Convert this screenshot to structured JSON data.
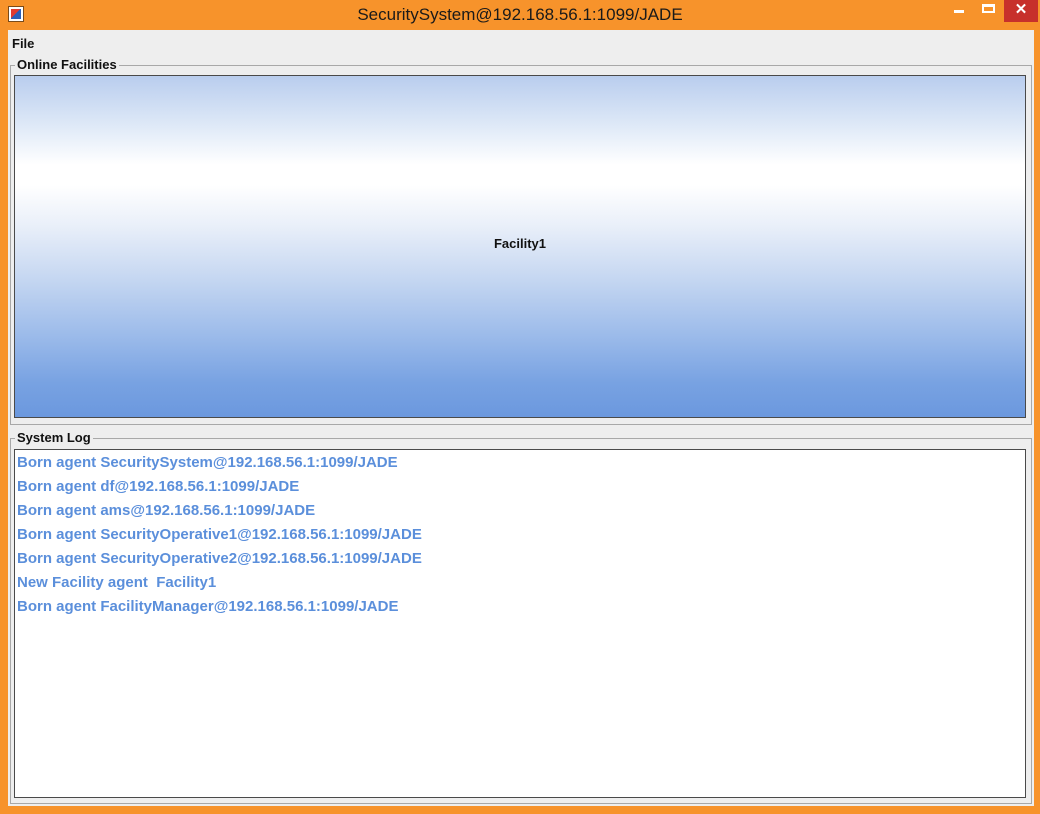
{
  "window": {
    "title": "SecuritySystem@192.168.56.1:1099/JADE",
    "close_glyph": "✕",
    "icon": "java-app-icon"
  },
  "menu": {
    "file_label": "File"
  },
  "facilities_panel": {
    "title": "Online Facilities",
    "items": [
      "Facility1"
    ]
  },
  "log_panel": {
    "title": "System Log",
    "lines": [
      "Born agent SecuritySystem@192.168.56.1:1099/JADE",
      "Born agent df@192.168.56.1:1099/JADE",
      "Born agent ams@192.168.56.1:1099/JADE",
      "Born agent SecurityOperative1@192.168.56.1:1099/JADE",
      "Born agent SecurityOperative2@192.168.56.1:1099/JADE",
      "New Facility agent  Facility1",
      "Born agent FacilityManager@192.168.56.1:1099/JADE"
    ]
  },
  "colors": {
    "frame": "#f7932b",
    "close_button": "#c7302b",
    "log_text": "#5b8fdb"
  }
}
